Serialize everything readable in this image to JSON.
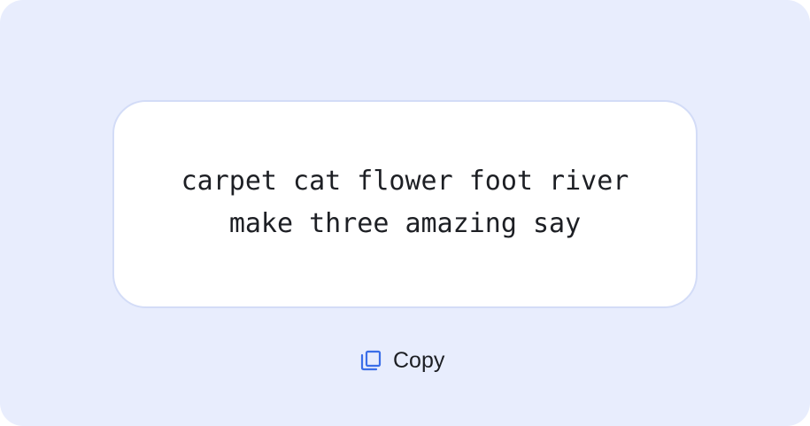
{
  "phrase_card": {
    "lines": [
      "carpet cat flower foot river",
      "make three amazing say"
    ]
  },
  "copy_button": {
    "label": "Copy",
    "icon": "copy-icon"
  },
  "colors": {
    "background": "#e8edfd",
    "card": "#ffffff",
    "card_border": "#d3dcf7",
    "accent": "#3b6ee8",
    "text": "#1d1f24"
  }
}
